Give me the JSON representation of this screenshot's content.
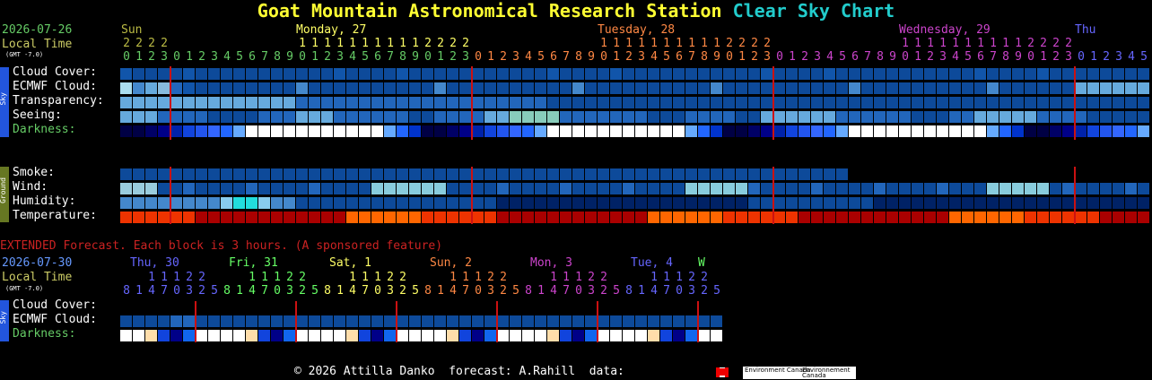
{
  "title": {
    "part1": "Goat Mountain Astronomical Research Station",
    "part2": "Clear Sky Chart"
  },
  "colors": {
    "title1": "#ffff33",
    "title2": "#22cccc",
    "date": "#66cc66",
    "local": "#cccc66"
  },
  "main": {
    "date": "2026-07-26",
    "local_time": "Local Time",
    "gmt": "(GMT -7.0)",
    "days": [
      {
        "label": "Sun",
        "color": "#bbbb44"
      },
      {
        "label": "Monday, 27",
        "color": "#ffff66"
      },
      {
        "label": "Tuesday, 28",
        "color": "#ff8844"
      },
      {
        "label": "Wednesday, 29",
        "color": "#cc44cc"
      },
      {
        "label": "Thu",
        "color": "#6666ff"
      }
    ],
    "sky_labels": [
      "Cloud Cover:",
      "ECMWF Cloud:",
      "Transparency:",
      "Seeing:",
      "Darkness:"
    ],
    "ground_labels": [
      "Smoke:",
      "Wind:",
      "Humidity:",
      "Temperature:"
    ],
    "sky_tab": "Sky",
    "ground_tab": "Ground"
  },
  "extended": {
    "note": "EXTENDED Forecast. Each block is 3 hours. (A sponsored feature)",
    "date": "2026-07-30",
    "local_time": "Local Time",
    "gmt": "(GMT -7.0)",
    "days": [
      {
        "label": "Thu, 30",
        "color": "#6666ff"
      },
      {
        "label": "Fri, 31",
        "color": "#66ff66"
      },
      {
        "label": "Sat, 1",
        "color": "#ffff66"
      },
      {
        "label": "Sun, 2",
        "color": "#ff8844"
      },
      {
        "label": "Mon, 3",
        "color": "#cc44cc"
      },
      {
        "label": "Tue, 4",
        "color": "#6666ff"
      },
      {
        "label": "W",
        "color": "#66ff66"
      }
    ],
    "hours_top": "  11122 ",
    "hours_bottom": "81470325",
    "sky_labels": [
      "Cloud Cover:",
      "ECMWF Cloud:",
      "Darkness:"
    ],
    "sky_tab": "Sky"
  },
  "footer": {
    "text": "© 2026 Attilla Danko  forecast: A.Rahill  data:",
    "ec1": "Environment Canada",
    "ec2": "Environnement Canada"
  }
}
